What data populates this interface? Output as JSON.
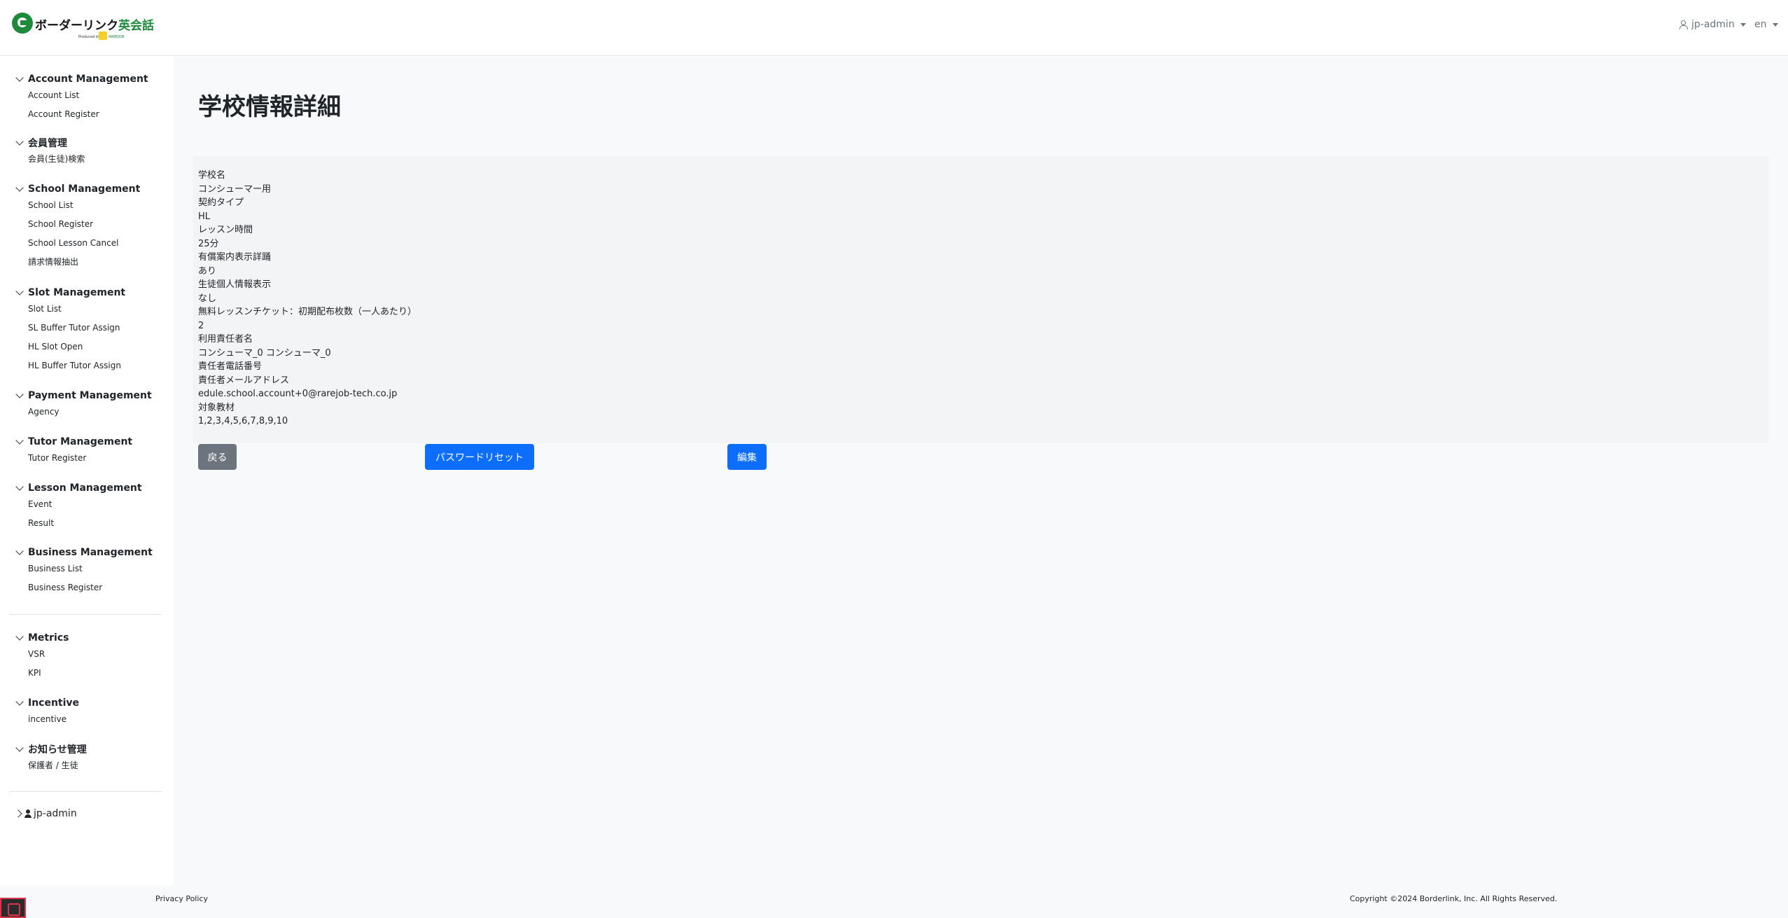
{
  "header": {
    "logo_text_main": "ボーダーリンク",
    "logo_text_accent": "英会話",
    "logo_sub": "Produced by",
    "logo_badge_text": "RAREJOB",
    "user": "jp-admin",
    "lang": "en"
  },
  "sidebar": {
    "groups": [
      {
        "title": "Account Management",
        "items": [
          "Account List",
          "Account Register"
        ]
      },
      {
        "title": "会員管理",
        "items": [
          "会員(生徒)検索"
        ]
      },
      {
        "title": "School Management",
        "items": [
          "School List",
          "School Register",
          "School Lesson Cancel",
          "請求情報抽出"
        ]
      },
      {
        "title": "Slot Management",
        "items": [
          "Slot List",
          "SL Buffer Tutor Assign",
          "HL Slot Open",
          "HL Buffer Tutor Assign"
        ]
      },
      {
        "title": "Payment Management",
        "items": [
          "Agency"
        ]
      },
      {
        "title": "Tutor Management",
        "items": [
          "Tutor Register"
        ]
      },
      {
        "title": "Lesson Management",
        "items": [
          "Event",
          "Result"
        ]
      },
      {
        "title": "Business Management",
        "items": [
          "Business List",
          "Business Register"
        ]
      },
      {
        "title": "Metrics",
        "items": [
          "VSR",
          "KPI"
        ]
      },
      {
        "title": "Incentive",
        "items": [
          "incentive"
        ]
      },
      {
        "title": "お知らせ管理",
        "items": [
          "保護者 / 生徒"
        ]
      }
    ],
    "user": "jp-admin"
  },
  "main": {
    "title": "学校情報詳細",
    "details": [
      "学校名",
      "コンシューマー用",
      "契約タイプ",
      "HL",
      "レッスン時間",
      "25分",
      "有償案内表示詳踊",
      "あり",
      "生徒個人情報表示",
      "なし",
      "無料レッスンチケット：初期配布枚数（一人あたり）",
      "2",
      "利用責任者名",
      "コンシューマ_0 コンシューマ_0",
      "責任者電話番号",
      "責任者メールアドレス",
      "edule.school.account+0@rarejob-tech.co.jp",
      "対象教材",
      "1,2,3,4,5,6,7,8,9,10"
    ],
    "buttons": {
      "back": "戻る",
      "password_reset": "パスワードリセット",
      "edit": "編集"
    }
  },
  "footer": {
    "privacy": "Privacy Policy",
    "copyright": "Copyright ©2024 Borderlink, Inc. All Rights Reserved."
  },
  "colors": {
    "primary": "#0d6efd",
    "secondary": "#6c757d",
    "brand_green": "#1e8a3b"
  }
}
